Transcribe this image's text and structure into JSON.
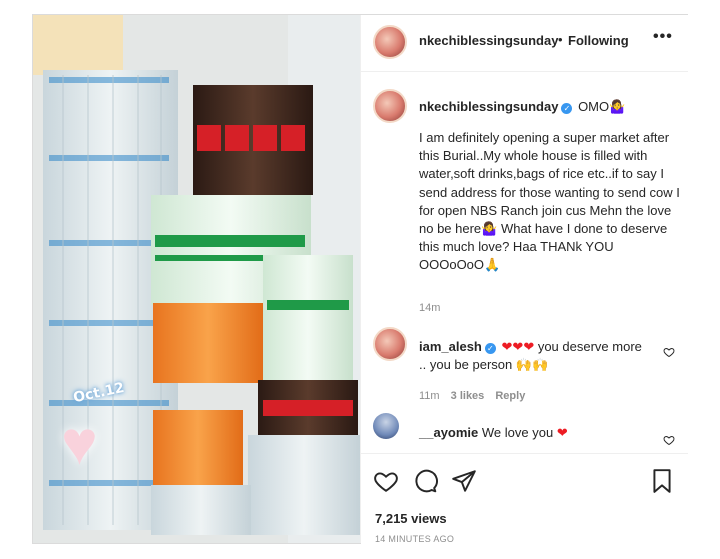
{
  "header": {
    "username": "nkechiblessingsunday",
    "separator": "•",
    "follow_status": "Following",
    "more_label": "•••"
  },
  "caption": {
    "username": "nkechiblessingsunday",
    "verified_mark": "✓",
    "title": "OMO🤷‍♀️",
    "text": "I am definitely opening a super market after this Burial..My whole house is filled with water,soft drinks,bags of rice etc..if to say I send address for those wanting to send cow I for open NBS Ranch join cus Mehn the love no be here🤷‍♀️ What have I done to deserve this much love? Haa THANk YOU OOOoOoO🙏",
    "time": "14m"
  },
  "comments": [
    {
      "username": "iam_alesh",
      "verified_mark": "✓",
      "text": "❤❤❤ you deserve more .. you be person 🙌🙌",
      "time": "11m",
      "likes": "3 likes",
      "reply": "Reply"
    },
    {
      "username": "__ayomie",
      "text": "We love you ❤"
    }
  ],
  "media": {
    "sticker_text": "Oct.12",
    "sticker_heart": "♥"
  },
  "stats": {
    "views": "7,215 views",
    "posted": "14 MINUTES AGO"
  },
  "icons": [
    "heart-icon",
    "comment-icon",
    "share-icon",
    "bookmark-icon",
    "more-icon",
    "verified-icon"
  ],
  "colors": {
    "verified": "#3897f0",
    "heart": "#ed1c24",
    "muted": "#8e8e8e"
  }
}
